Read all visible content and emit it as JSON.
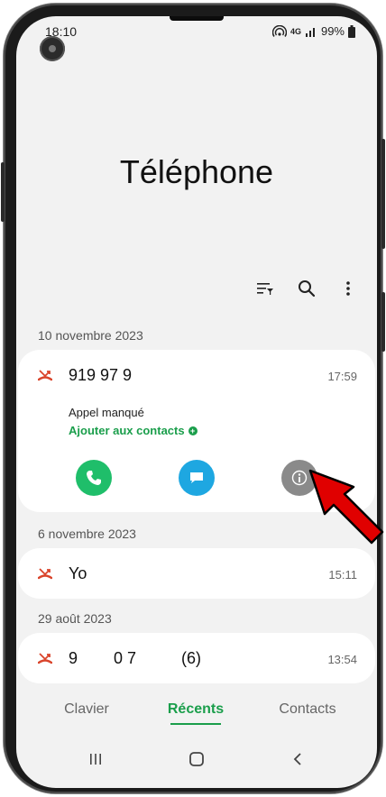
{
  "status": {
    "time": "18:10",
    "network": "4G",
    "battery": "99%"
  },
  "app": {
    "title": "Téléphone"
  },
  "toolbar": {
    "filter_icon": "filter-list-icon",
    "search_icon": "search-icon",
    "more_icon": "more-vertical-icon"
  },
  "sections": [
    {
      "date": "10 novembre 2023",
      "entries": [
        {
          "number": "919 97 9",
          "time": "17:59",
          "type": "Appel manqué",
          "add_contact": "Ajouter aux contacts"
        }
      ]
    },
    {
      "date": "6 novembre 2023",
      "entries": [
        {
          "number": "Yo",
          "time": "15:11"
        }
      ]
    },
    {
      "date": "29 août 2023",
      "entries": [
        {
          "number": "9        0 7          (6)",
          "time": "13:54"
        }
      ]
    }
  ],
  "actions": {
    "call_icon": "phone-icon",
    "message_icon": "message-icon",
    "info_icon": "info-icon"
  },
  "colors": {
    "accent": "#1a9e4b",
    "missed": "#d9442b",
    "message": "#1ea7e1",
    "info": "#8a8a8a",
    "arrow": "#e00000"
  },
  "tabs": [
    {
      "label": "Clavier",
      "active": false
    },
    {
      "label": "Récents",
      "active": true
    },
    {
      "label": "Contacts",
      "active": false
    }
  ],
  "nav": {
    "recent_icon": "recent-apps-icon",
    "home_icon": "home-icon",
    "back_icon": "back-icon"
  }
}
